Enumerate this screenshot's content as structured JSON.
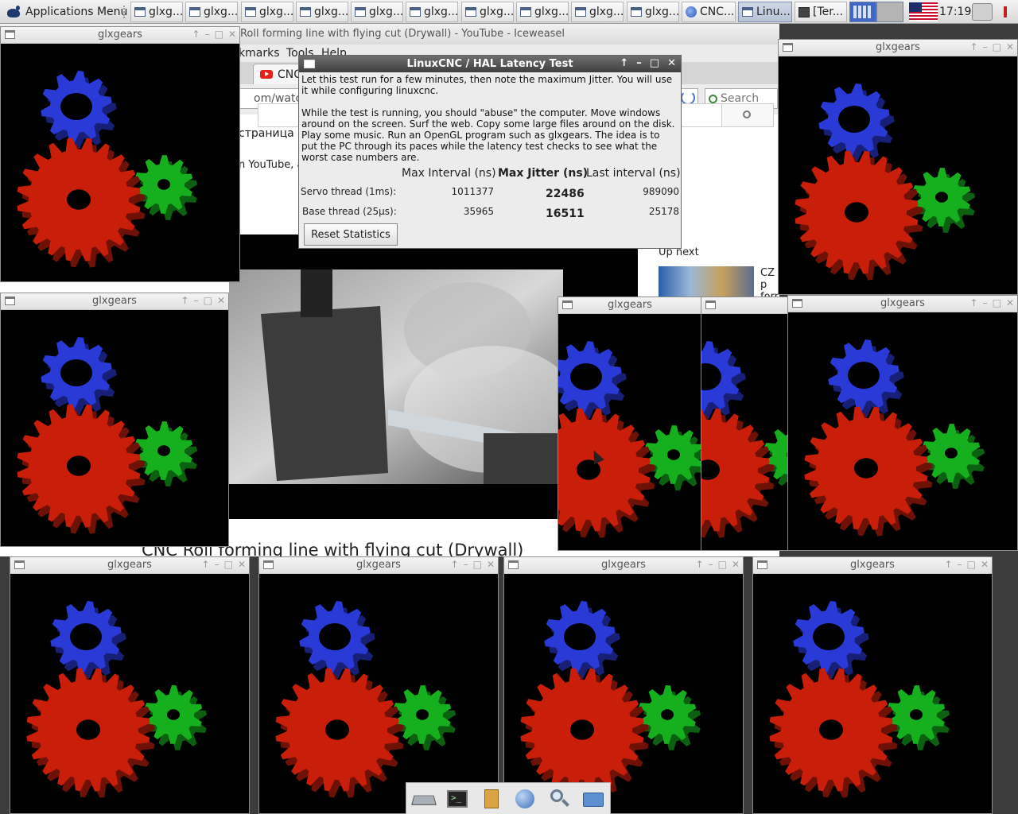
{
  "panel": {
    "app_menu_label": "Applications Menu",
    "tasks": [
      {
        "label": "glxg...",
        "icon": "window-icon"
      },
      {
        "label": "glxg...",
        "icon": "window-icon"
      },
      {
        "label": "glxg...",
        "icon": "window-icon"
      },
      {
        "label": "glxg...",
        "icon": "window-icon"
      },
      {
        "label": "glxg...",
        "icon": "window-icon"
      },
      {
        "label": "glxg...",
        "icon": "window-icon"
      },
      {
        "label": "glxg...",
        "icon": "window-icon"
      },
      {
        "label": "glxg...",
        "icon": "window-icon"
      },
      {
        "label": "glxg...",
        "icon": "window-icon"
      },
      {
        "label": "glxg...",
        "icon": "window-icon"
      },
      {
        "label": "CNC...",
        "icon": "globe-icon"
      },
      {
        "label": "Linu...",
        "icon": "window-icon",
        "active": true
      },
      {
        "label": "[Ter...",
        "icon": "terminal-icon"
      }
    ],
    "clock": "17:19"
  },
  "browser": {
    "window_title": "CNC Roll forming line with flying cut (Drywall) - YouTube - Iceweasel",
    "menu": {
      "bookmarks": "kmarks",
      "tools": "Tools",
      "help": "Help"
    },
    "tab_label": "CNC",
    "url_fragment": "om/watch?v",
    "search_placeholder": "Search",
    "page_fragment_1": "страница .",
    "page_fragment_2": "n YouTube, a",
    "up_next": "Up next",
    "side_text_1": "CZ p",
    "side_text_2": "forr",
    "video_title": "CNC Roll forming line with flying cut (Drywall)"
  },
  "latency": {
    "window_title": "LinuxCNC / HAL Latency Test",
    "text_1": "Let this test run for a few minutes, then note the maximum Jitter.  You will use it while configuring linuxcnc.",
    "text_2": "While the test is running, you should \"abuse\" the computer. Move windows around on the screen. Surf the web. Copy some large files around on the disk. Play some music. Run an OpenGL program such as glxgears. The idea is to put the PC through its paces while the latency test checks to see what the worst case numbers are.",
    "headers": {
      "max_interval": "Max Interval (ns)",
      "max_jitter": "Max Jitter (ns)",
      "last_interval": "Last interval (ns)"
    },
    "rows": [
      {
        "label": "Servo thread (1ms):",
        "max_interval": "1011377",
        "max_jitter": "22486",
        "last_interval": "989090"
      },
      {
        "label": "Base thread (25µs):",
        "max_interval": "35965",
        "max_jitter": "16511",
        "last_interval": "25178"
      }
    ],
    "reset_label": "Reset Statistics"
  },
  "glxgears": {
    "title": "glxgears",
    "window_count": 11,
    "gear_colors": {
      "red": "#c81e0a",
      "green": "#16b01e",
      "blue": "#2a3ad6"
    }
  },
  "dock": {
    "items": [
      "show-desktop-icon",
      "terminal-icon",
      "file-manager-icon",
      "web-browser-icon",
      "search-icon",
      "folder-icon"
    ]
  }
}
